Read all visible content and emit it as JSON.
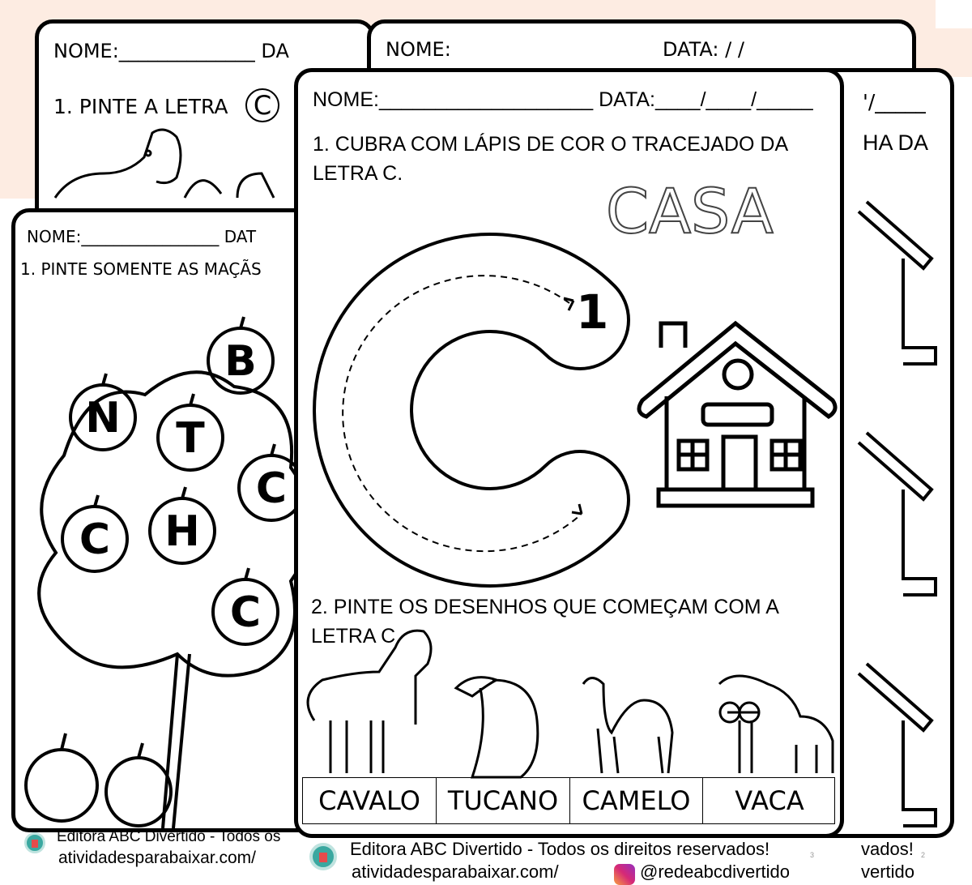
{
  "back_card_top_left": {
    "name_line": "NOME:______________ DA",
    "task": "1. PINTE A LETRA",
    "letter": "C"
  },
  "back_card_top_mid": {
    "name": "NOME:",
    "date": "DATA:      /      /"
  },
  "left_card": {
    "name_line": "NOME:_________________ DAT",
    "task": "1. PINTE SOMENTE AS MAÇÃS",
    "apples": [
      "B",
      "N",
      "T",
      "C",
      "C",
      "H",
      "C"
    ]
  },
  "right_card": {
    "date_tail": "'/_____",
    "task_tail": "HA DA"
  },
  "main_card": {
    "name_line": "NOME:___________________  DATA:____/____/_____",
    "task1_line1": "1.  CUBRA  COM  LÁPIS  DE  COR  O  TRACEJADO  DA",
    "task1_line2": "LETRA C.",
    "word": "CASA",
    "stroke_number": "1",
    "task2_line1": "2.  PINTE  OS  DESENHOS  QUE  COMEÇAM  COM  A",
    "task2_line2": "LETRA C.",
    "animals": [
      "CAVALO",
      "TUCANO",
      "CAMELO",
      "VACA"
    ]
  },
  "footer": {
    "publisher": "Editora ABC Divertido - Todos os direitos reservados!",
    "publisher_short": "Editora ABC Divertido - Todos os",
    "site": "atividadesparabaixar.com/",
    "instagram": "@redeabcdivertido",
    "page_main": "3",
    "page_right": "2",
    "right_tail": "vados!",
    "right_tail2": "vertido",
    "logo_text": "Atividades para Baixar"
  }
}
